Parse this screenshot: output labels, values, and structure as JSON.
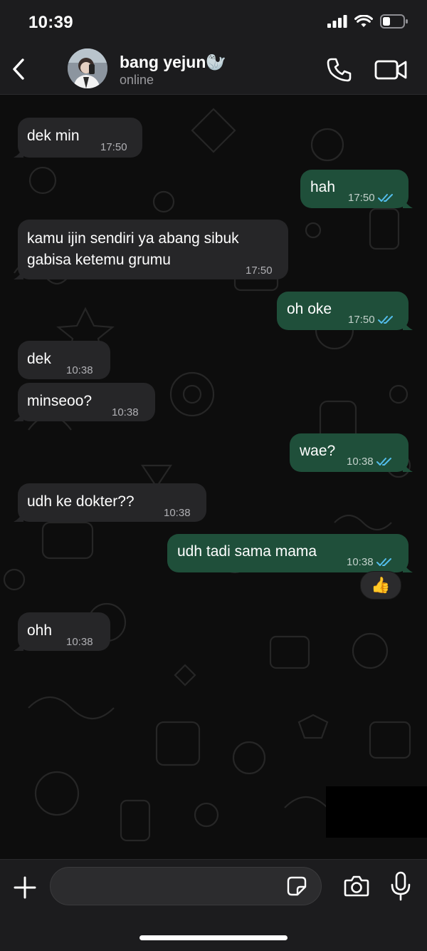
{
  "status_bar": {
    "time": "10:39"
  },
  "header": {
    "contact_name": "bang yejun🦭",
    "contact_status": "online"
  },
  "messages": [
    {
      "direction": "in",
      "text": "dek min",
      "time": "17:50"
    },
    {
      "direction": "out",
      "text": "hah",
      "time": "17:50",
      "read": true
    },
    {
      "direction": "in",
      "text": "kamu ijin sendiri ya abang sibuk gabisa ketemu grumu",
      "time": "17:50"
    },
    {
      "direction": "out",
      "text": "oh oke",
      "time": "17:50",
      "read": true
    },
    {
      "direction": "in",
      "text": "dek",
      "time": "10:38"
    },
    {
      "direction": "in",
      "text": "minseoo?",
      "time": "10:38"
    },
    {
      "direction": "out",
      "text": "wae?",
      "time": "10:38",
      "read": true
    },
    {
      "direction": "in",
      "text": "udh ke dokter??",
      "time": "10:38"
    },
    {
      "direction": "out",
      "text": "udh tadi sama mama",
      "time": "10:38",
      "read": true,
      "reaction": "👍"
    },
    {
      "direction": "in",
      "text": "ohh",
      "time": "10:38"
    }
  ],
  "composer": {
    "value": "",
    "placeholder": ""
  },
  "colors": {
    "incoming_bubble": "#262628",
    "outgoing_bubble": "#1f4f3a",
    "read_ticks": "#53bdeb",
    "bars": "#1c1c1e"
  }
}
